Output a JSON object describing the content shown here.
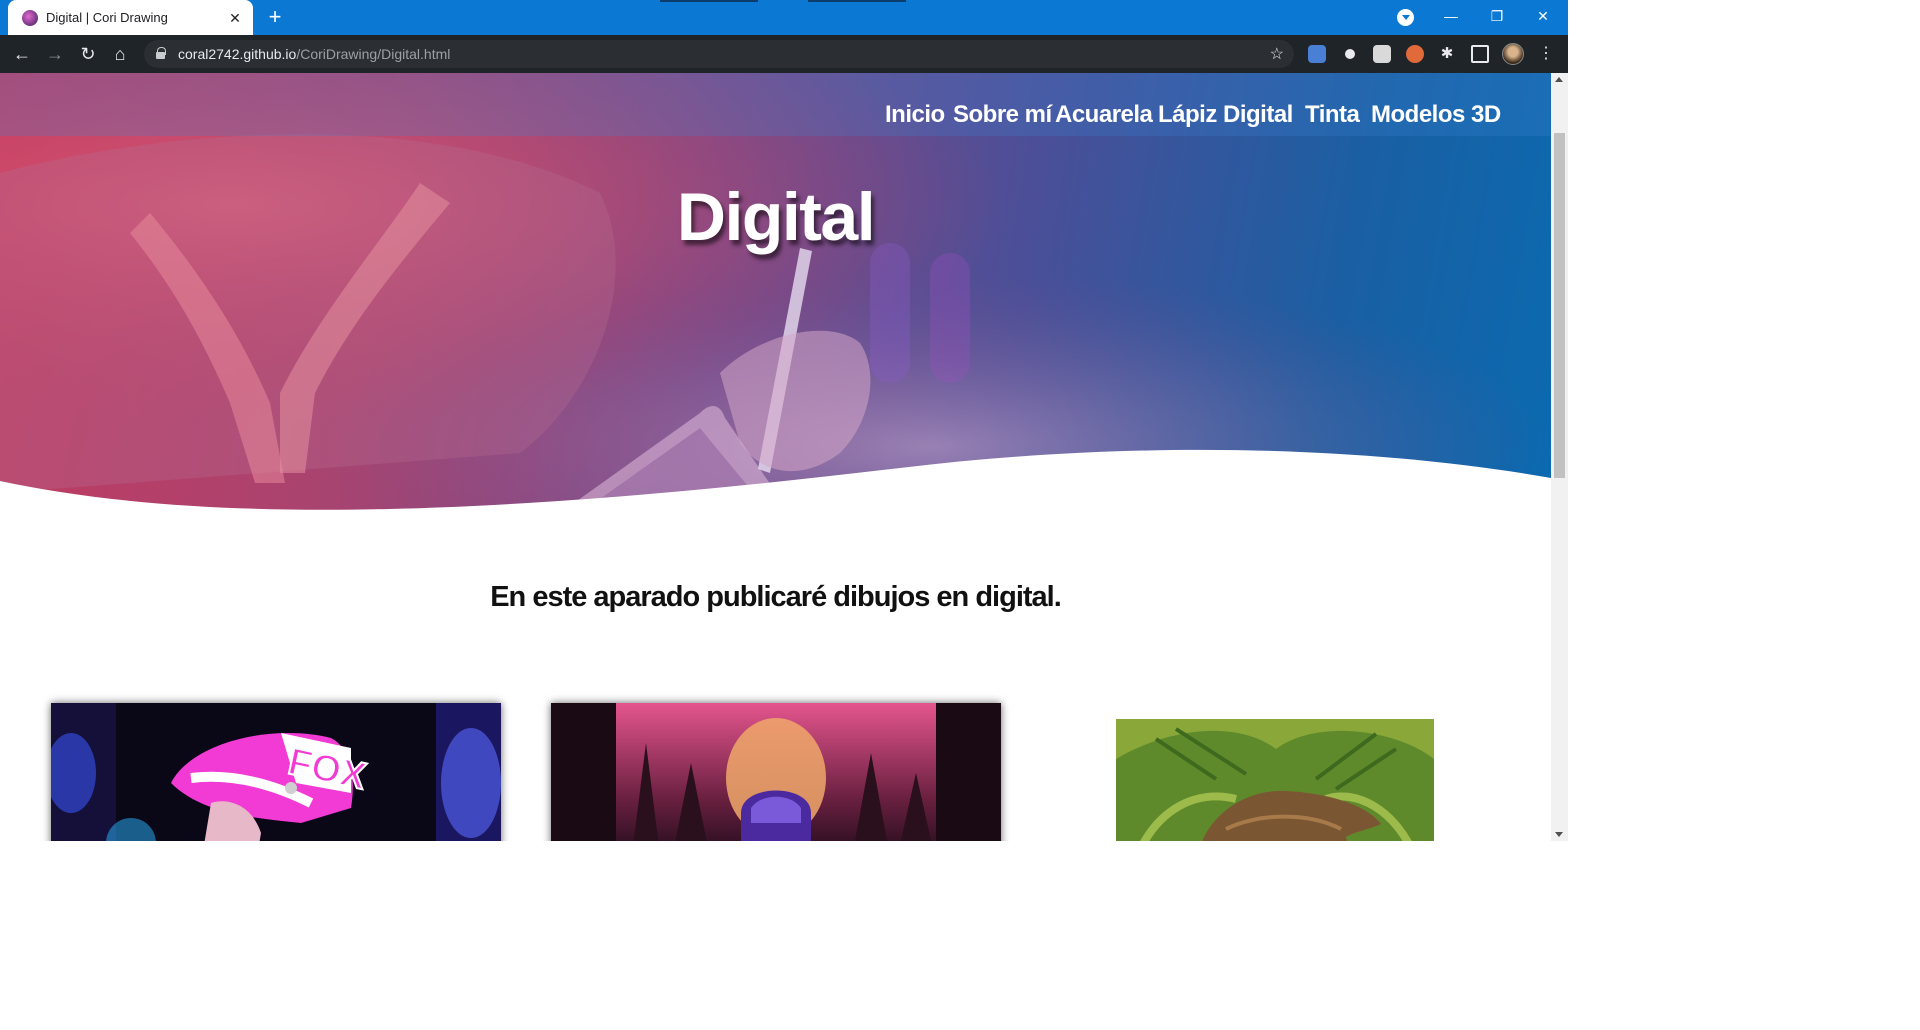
{
  "browser": {
    "tab_title": "Digital | Cori Drawing",
    "url_host": "coral2742.github.io",
    "url_path": "/CoriDrawing/Digital.html"
  },
  "site": {
    "nav": [
      "Inicio",
      "Sobre mí",
      "Acuarela",
      "Lápiz",
      "Digital",
      "Tinta",
      "Modelos 3D"
    ],
    "hero_title": "Digital",
    "intro_text": "En este aparado publicaré dibujos en digital."
  },
  "gallery": [
    {
      "subject": "helmet-fox-drawing",
      "helmet_text": "FOX"
    },
    {
      "subject": "astronaut-forest-drawing"
    },
    {
      "subject": "portrait-palm-drawing"
    }
  ],
  "colors": {
    "tabbar": "#0b78d4",
    "toolbar": "#1f2428",
    "hero_start": "#c23a5f",
    "hero_end": "#0b6ab0"
  }
}
